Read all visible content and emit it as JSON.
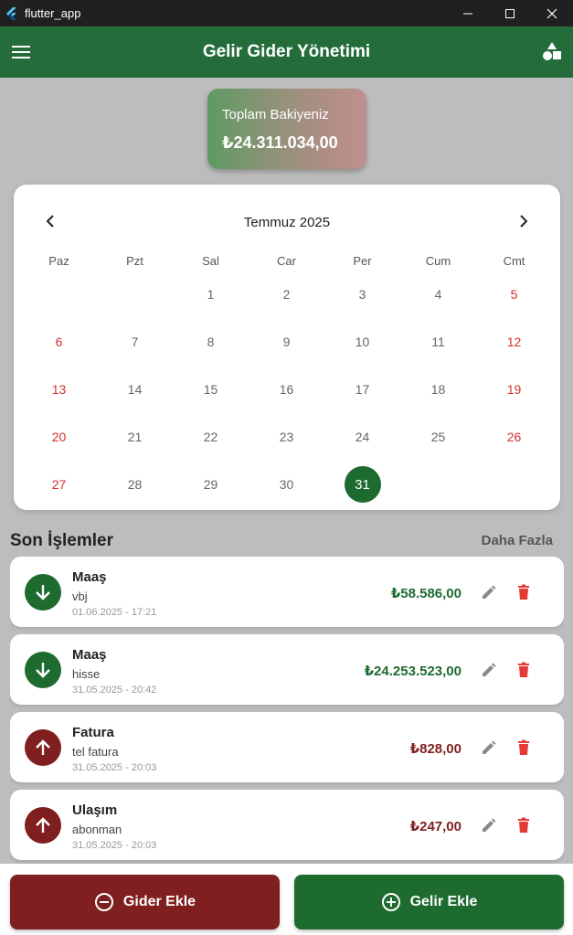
{
  "window": {
    "title": "flutter_app"
  },
  "appbar": {
    "title": "Gelir Gider Yönetimi",
    "menu_icon": "menu-icon",
    "shapes_icon": "category-icon"
  },
  "balance": {
    "label": "Toplam Bakiyeniz",
    "value": "₺24.311.034,00"
  },
  "calendar": {
    "month": "Temmuz 2025",
    "weekdays": [
      "Paz",
      "Pzt",
      "Sal",
      "Car",
      "Per",
      "Cum",
      "Cmt"
    ],
    "weeks": [
      [
        "",
        "",
        "1",
        "2",
        "3",
        "4",
        "5"
      ],
      [
        "6",
        "7",
        "8",
        "9",
        "10",
        "11",
        "12"
      ],
      [
        "13",
        "14",
        "15",
        "16",
        "17",
        "18",
        "19"
      ],
      [
        "20",
        "21",
        "22",
        "23",
        "24",
        "25",
        "26"
      ],
      [
        "27",
        "28",
        "29",
        "30",
        "31",
        "",
        ""
      ]
    ],
    "selected_day": "31"
  },
  "recent": {
    "title": "Son İşlemler",
    "more": "Daha Fazla"
  },
  "transactions": [
    {
      "category": "Maaş",
      "description": "vbj",
      "date": "01.06.2025 - 17:21",
      "amount": "₺58.586,00",
      "type": "income"
    },
    {
      "category": "Maaş",
      "description": "hisse",
      "date": "31.05.2025 - 20:42",
      "amount": "₺24.253.523,00",
      "type": "income"
    },
    {
      "category": "Fatura",
      "description": "tel fatura",
      "date": "31.05.2025 - 20:03",
      "amount": "₺828,00",
      "type": "expense"
    },
    {
      "category": "Ulaşım",
      "description": "abonman",
      "date": "31.05.2025 - 20:03",
      "amount": "₺247,00",
      "type": "expense"
    }
  ],
  "actions": {
    "expense_label": "Gider Ekle",
    "income_label": "Gelir Ekle"
  },
  "colors": {
    "income": "#1e6b30",
    "expense": "#7f1f1f",
    "appbar": "#246d3b",
    "weekend": "#d32f2f",
    "delete": "#e53935"
  }
}
